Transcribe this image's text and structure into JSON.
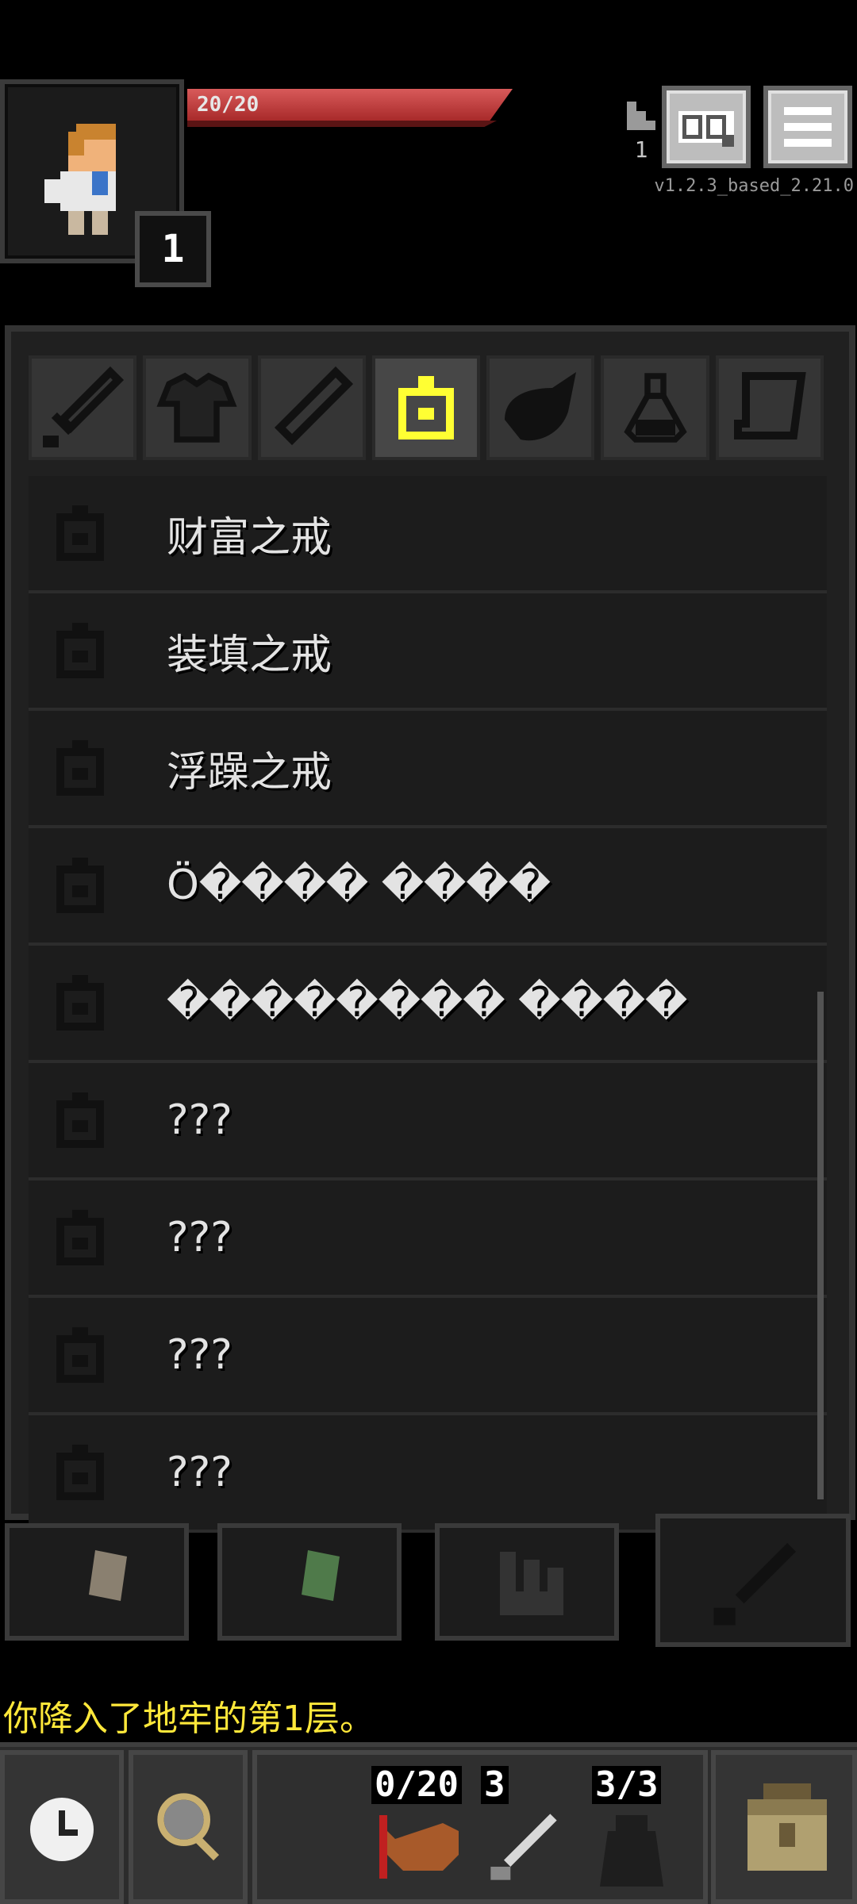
{
  "hero": {
    "hp_text": "20/20",
    "hp_fraction": 1.0,
    "level": "1"
  },
  "depth": {
    "value": "1"
  },
  "version": "v1.2.3_based_2.21.0",
  "tabs": [
    {
      "icon": "sword-icon",
      "active": false
    },
    {
      "icon": "armor-icon",
      "active": false
    },
    {
      "icon": "wand-icon",
      "active": false
    },
    {
      "icon": "ring-icon",
      "active": true
    },
    {
      "icon": "food-icon",
      "active": false
    },
    {
      "icon": "potion-icon",
      "active": false
    },
    {
      "icon": "scroll-icon",
      "active": false
    }
  ],
  "items": [
    {
      "label": "财富之戒"
    },
    {
      "label": "装填之戒"
    },
    {
      "label": "浮躁之戒"
    },
    {
      "label": "Ö���� ����"
    },
    {
      "label": "�������� ����"
    },
    {
      "label": "???"
    },
    {
      "label": "???"
    },
    {
      "label": "???"
    },
    {
      "label": "???"
    }
  ],
  "log": {
    "message": "你降入了地牢的第1层。"
  },
  "toolbar": {
    "food_count": "0/20",
    "dart_count": "3",
    "cloak_count": "3/3"
  },
  "colors": {
    "accent": "#ffe83a",
    "hp": "#c03a3a"
  }
}
